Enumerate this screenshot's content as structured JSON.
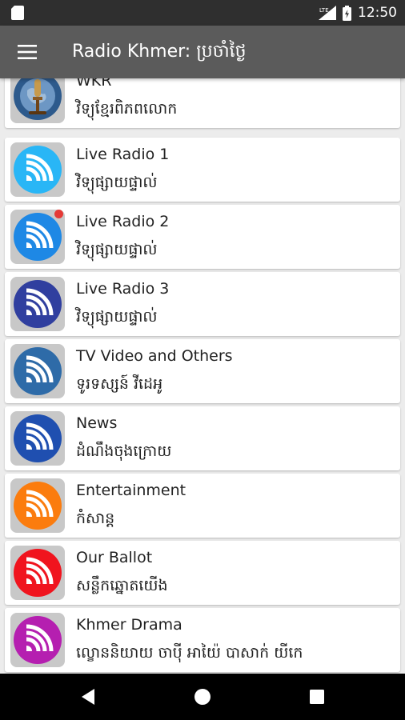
{
  "status_bar": {
    "time": "12:50",
    "network": "LTE"
  },
  "app_bar": {
    "title": "Radio Khmer: ប្រចាំថ្ងៃ",
    "menu_icon": "hamburger-menu-icon"
  },
  "items": [
    {
      "title": "WKR",
      "subtitle": "វិទ្យុខ្មែរពិភពលោក",
      "icon": "globe-microphone-icon"
    },
    {
      "title": "Live Radio 1",
      "subtitle": "វិទ្យុផ្សាយផ្ទាល់",
      "icon": "broadcast-icon",
      "color": "#29b6f6"
    },
    {
      "title": "Live Radio 2",
      "subtitle": "វិទ្យុផ្សាយផ្ទាល់",
      "icon": "broadcast-icon",
      "color": "#1e88e5",
      "badge": true
    },
    {
      "title": "Live Radio 3",
      "subtitle": "វិទ្យុផ្សាយផ្ទាល់",
      "icon": "broadcast-icon",
      "color": "#303f9f"
    },
    {
      "title": "TV Video and Others",
      "subtitle": "ទូរទស្សន៍ វីដេអូ",
      "icon": "broadcast-icon",
      "color": "#2e6ba8"
    },
    {
      "title": "News",
      "subtitle": "ដំណឹងចុងក្រោយ",
      "icon": "broadcast-icon",
      "color": "#1f4fb0"
    },
    {
      "title": "Entertainment",
      "subtitle": "កំសាន្ត",
      "icon": "broadcast-icon",
      "color": "#fb7c0e"
    },
    {
      "title": "Our Ballot",
      "subtitle": "សន្លឹកឆ្នោតយើង",
      "icon": "broadcast-icon",
      "color": "#f0141e"
    },
    {
      "title": "Khmer Drama",
      "subtitle": "ល្ខោននិយាយ ចាប៉ី អាយ៉ៃ បាសាក់ យីកេ",
      "icon": "broadcast-icon",
      "color": "#b51fb0"
    }
  ],
  "nav_bar": {
    "back_icon": "back-triangle-icon",
    "home_icon": "home-circle-icon",
    "recents_icon": "recents-square-icon"
  }
}
